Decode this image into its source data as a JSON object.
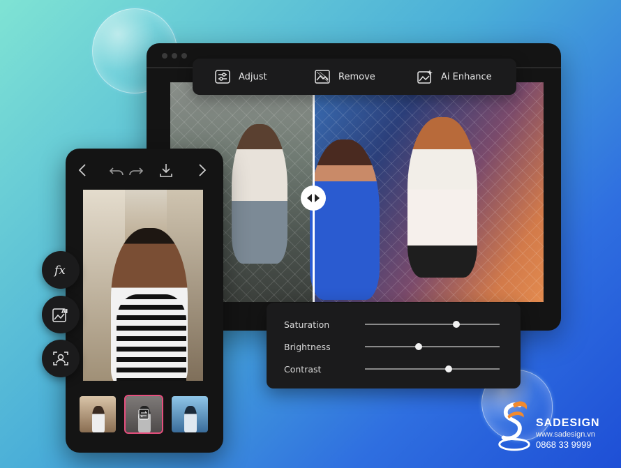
{
  "toolbar": {
    "tools": [
      {
        "label": "Adjust",
        "icon": "sliders-icon"
      },
      {
        "label": "Remove",
        "icon": "remove-icon"
      },
      {
        "label": "Ai Enhance",
        "icon": "ai-enhance-icon"
      }
    ]
  },
  "adjustments": [
    {
      "label": "Saturation",
      "value": 0.68
    },
    {
      "label": "Brightness",
      "value": 0.4
    },
    {
      "label": "Contrast",
      "value": 0.62
    }
  ],
  "phone": {
    "nav_icons": [
      "chevron-left-icon",
      "undo-icon",
      "redo-icon",
      "download-icon",
      "chevron-right-icon"
    ]
  },
  "side_tools": [
    {
      "label": "fx",
      "icon": "fx-icon"
    },
    {
      "label": "AI",
      "icon": "ai-image-icon"
    },
    {
      "label": "",
      "icon": "face-scan-icon"
    }
  ],
  "brand": {
    "name": "SADESIGN",
    "url": "www.sadesign.vn",
    "phone": "0868 33 9999"
  },
  "colors": {
    "panel": "#1b1b1c",
    "accent_pink": "#e64f7e",
    "logo_orange": "#f28a2e"
  }
}
